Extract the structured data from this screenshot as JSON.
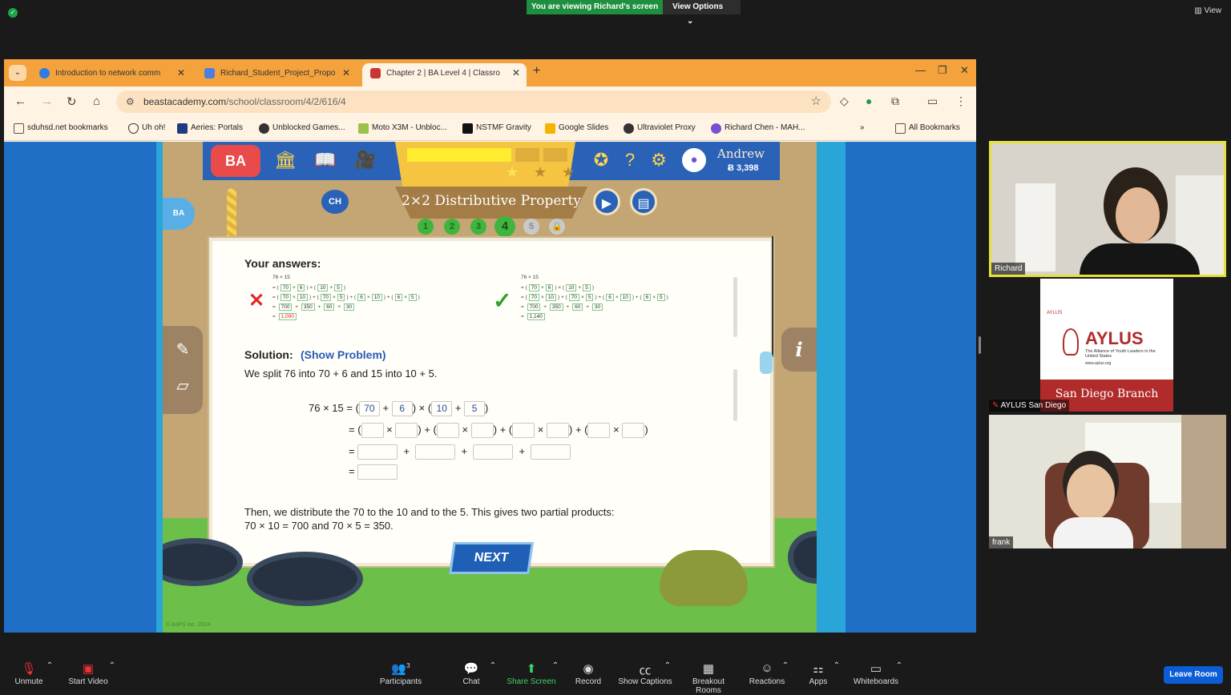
{
  "zoom": {
    "viewing_text": "You are viewing Richard's screen",
    "view_options": "View Options",
    "view_label": "View",
    "leave_label": "Leave Room",
    "toolbar": [
      {
        "label": "Unmute",
        "icon": "mic-muted-icon"
      },
      {
        "label": "Start Video",
        "icon": "video-off-icon"
      },
      {
        "label": "Participants",
        "icon": "participants-icon",
        "count": "3"
      },
      {
        "label": "Chat",
        "icon": "chat-icon"
      },
      {
        "label": "Share Screen",
        "icon": "share-screen-icon"
      },
      {
        "label": "Record",
        "icon": "record-icon"
      },
      {
        "label": "Show Captions",
        "icon": "captions-icon"
      },
      {
        "label": "Breakout Rooms",
        "icon": "breakout-rooms-icon"
      },
      {
        "label": "Reactions",
        "icon": "reactions-icon"
      },
      {
        "label": "Apps",
        "icon": "apps-icon"
      },
      {
        "label": "Whiteboards",
        "icon": "whiteboards-icon"
      }
    ],
    "participants": [
      {
        "name": "Richard"
      },
      {
        "name": "AYLUS San Diego"
      },
      {
        "name": "frank"
      }
    ],
    "aylus_card": {
      "brand": "AYLUS",
      "small": "AYLUS",
      "subtitle": "The Alliance of Youth Leaders in the United States",
      "url": "www.aylus.org",
      "branch": "San Diego Branch"
    },
    "accent": "#0b5cd5",
    "share_color": "#1e8f3e"
  },
  "browser": {
    "tabs": [
      {
        "title": "Introduction to network comm",
        "close": "✕"
      },
      {
        "title": "Richard_Student_Project_Propo",
        "close": "✕"
      },
      {
        "title": "Chapter 2 | BA Level 4 | Classro",
        "close": "✕"
      }
    ],
    "url_domain": "beastacademy.com",
    "url_path": "/school/classroom/4/2/616/4",
    "bookmarks": [
      "sduhsd.net bookmarks",
      "Uh oh!",
      "Aeries: Portals",
      "Unblocked Games...",
      "Moto X3M - Unbloc...",
      "NSTMF Gravity",
      "Google Slides",
      "Ultraviolet Proxy",
      "Richard Chen - MAH..."
    ],
    "all_bookmarks": "All Bookmarks",
    "frame_color": "#f4a23c"
  },
  "lesson": {
    "logo": "BA",
    "ch_badge": "CH",
    "title": "2×2 Distributive Property",
    "steps": [
      "1",
      "2",
      "3",
      "4",
      "5"
    ],
    "current_step": "4",
    "user_name": "Andrew",
    "user_bucks": "Ƀ 3,398",
    "your_answers": "Your answers:",
    "wrong_attempt": {
      "header": "76 × 15",
      "row1": [
        "70",
        "6",
        "10",
        "5"
      ],
      "row2": [
        "70",
        "10",
        "70",
        "5",
        "6",
        "10",
        "6",
        "5"
      ],
      "row3": [
        "700",
        "350",
        "60",
        "30"
      ],
      "total": "1,090"
    },
    "right_attempt": {
      "header": "76 × 15",
      "row1": [
        "70",
        "6",
        "10",
        "5"
      ],
      "row2": [
        "70",
        "10",
        "70",
        "5",
        "6",
        "10",
        "6",
        "5"
      ],
      "row3": [
        "700",
        "350",
        "60",
        "30"
      ],
      "total": "1,140"
    },
    "solution_label": "Solution:",
    "show_problem": "(Show Problem)",
    "split_text": "We split 76 into 70 + 6 and 15 into 10 + 5.",
    "equation": {
      "lhs": "76 × 15 =",
      "boxes": [
        "70",
        "6",
        "10",
        "5"
      ]
    },
    "distribute_text_1": "Then, we distribute the 70 to the 10 and to the 5. This gives two partial products:",
    "distribute_text_2": "70 × 10 = 700 and 70 × 5 = 350.",
    "next_label": "NEXT",
    "copyright": "© AoPS Inc. 2024"
  }
}
